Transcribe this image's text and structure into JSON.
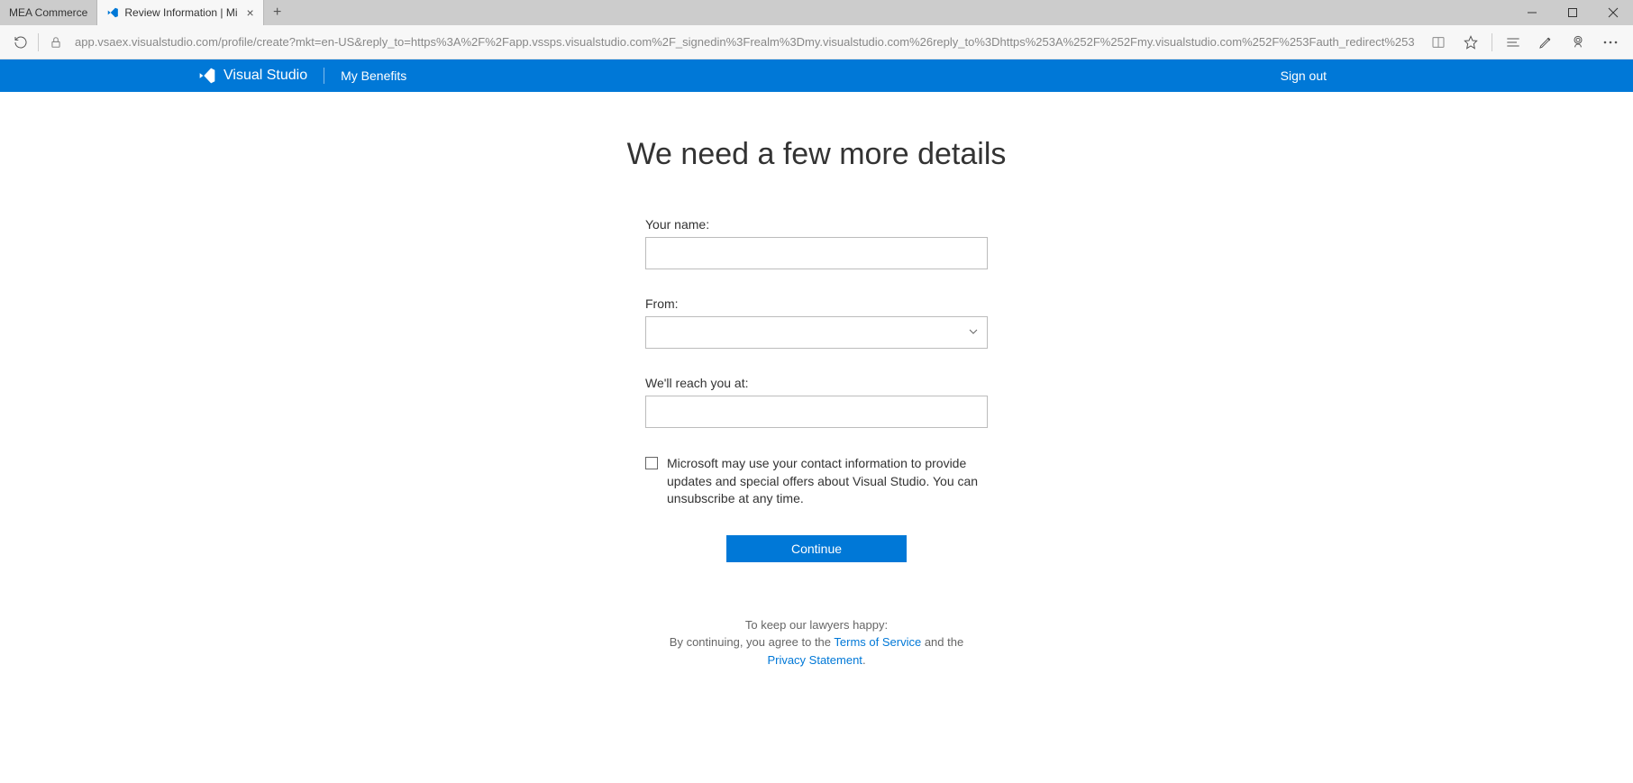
{
  "tabs": {
    "tab1_label": "MEA Commerce",
    "tab2_label": "Review Information | Mi"
  },
  "url": "app.vsaex.visualstudio.com/profile/create?mkt=en-US&reply_to=https%3A%2F%2Fapp.vssps.visualstudio.com%2F_signedin%3Frealm%3Dmy.visualstudio.com%26reply_to%3Dhttps%253A%252F%252Fmy.visualstudio.com%252F%253Fauth_redirect%253",
  "top_nav": {
    "brand": "Visual Studio",
    "my_benefits": "My Benefits",
    "sign_out": "Sign out"
  },
  "page": {
    "title": "We need a few more details"
  },
  "form": {
    "name_label": "Your name:",
    "from_label": "From:",
    "contact_label": "We'll reach you at:",
    "checkbox_label": "Microsoft may use your contact information to provide updates and special offers about Visual Studio. You can unsubscribe at any time.",
    "continue_label": "Continue"
  },
  "legal": {
    "line1": "To keep our lawyers happy:",
    "line2_prefix": "By continuing, you agree to the ",
    "terms": "Terms of Service",
    "line2_mid": " and the ",
    "privacy": "Privacy Statement",
    "line2_suffix": "."
  }
}
